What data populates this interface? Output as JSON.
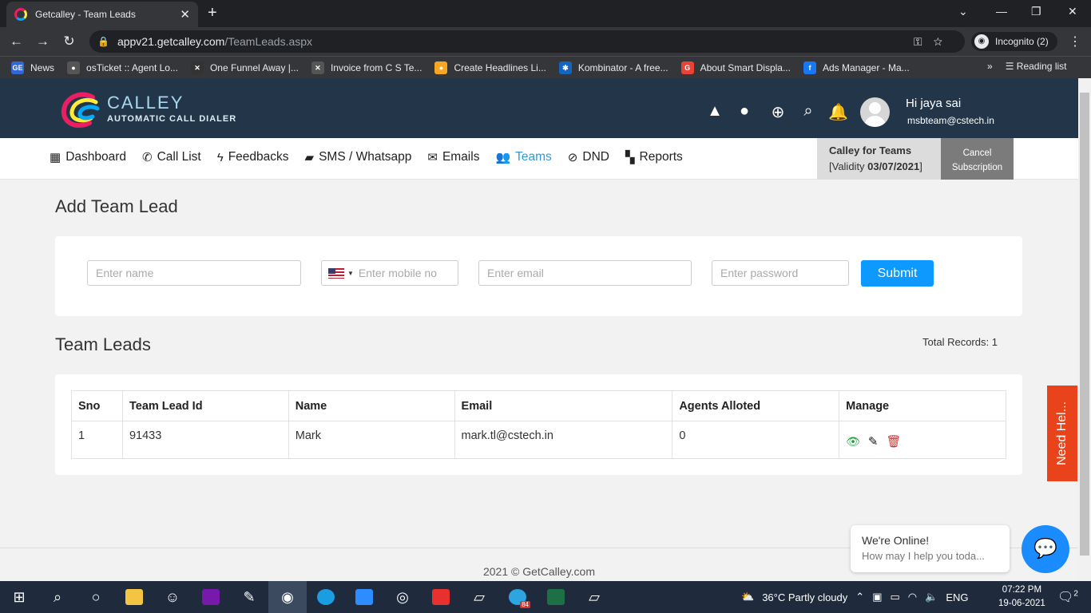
{
  "browser": {
    "tab_title": "Getcalley - Team Leads",
    "tab_close": "✕",
    "new_tab": "+",
    "url_host": "appv21.getcalley.com",
    "url_path": "/TeamLeads.aspx",
    "profile": "Incognito (2)",
    "bookmarks": [
      {
        "label": "News",
        "icon": "GE",
        "color": "#3367d6"
      },
      {
        "label": "osTicket :: Agent Lo...",
        "icon": "●",
        "color": "#555555"
      },
      {
        "label": "One Funnel Away |...",
        "icon": "✕",
        "color": "#333333"
      },
      {
        "label": "Invoice from C S Te...",
        "icon": "✕",
        "color": "#555555"
      },
      {
        "label": "Create Headlines Li...",
        "icon": "●",
        "color": "#f5a623"
      },
      {
        "label": "Kombinator - A free...",
        "icon": "✱",
        "color": "#1565c0"
      },
      {
        "label": "About Smart Displa...",
        "icon": "G",
        "color": "#ea4335"
      },
      {
        "label": "Ads Manager - Ma...",
        "icon": "f",
        "color": "#1877f2"
      }
    ],
    "more_bookmarks": "»",
    "reading_list": "Reading list"
  },
  "header": {
    "brand_name": "CALLEY",
    "brand_tagline": "AUTOMATIC CALL DIALER",
    "greeting": "Hi jaya sai",
    "user_email": "msbteam@cstech.in",
    "icons": [
      "android-icon",
      "apple-icon",
      "help-icon",
      "search-icon",
      "bell-icon"
    ]
  },
  "nav": {
    "items": [
      {
        "label": "Dashboard",
        "icon": "▦"
      },
      {
        "label": "Call List",
        "icon": "✆"
      },
      {
        "label": "Feedbacks",
        "icon": "ϟ"
      },
      {
        "label": "SMS / Whatsapp",
        "icon": "▰"
      },
      {
        "label": "Emails",
        "icon": "✉"
      },
      {
        "label": "Teams",
        "icon": "👥"
      },
      {
        "label": "DND",
        "icon": "⊘"
      },
      {
        "label": "Reports",
        "icon": "▚"
      }
    ],
    "active": "Teams",
    "plan_title": "Calley for Teams",
    "plan_validity_prefix": "[Validity ",
    "plan_validity_date": "03/07/2021",
    "plan_validity_suffix": "]",
    "cancel_label_1": "Cancel",
    "cancel_label_2": "Subscription"
  },
  "add_form": {
    "title": "Add Team Lead",
    "name_placeholder": "Enter name",
    "mobile_placeholder": "Enter mobile no",
    "email_placeholder": "Enter email",
    "password_placeholder": "Enter password",
    "submit_label": "Submit"
  },
  "team_leads": {
    "title": "Team Leads",
    "total_records": "Total Records: 1",
    "columns": [
      "Sno",
      "Team Lead Id",
      "Name",
      "Email",
      "Agents Alloted",
      "Manage"
    ],
    "rows": [
      {
        "sno": "1",
        "id": "91433",
        "name": "Mark",
        "email": "mark.tl@cstech.in",
        "agents": "0"
      }
    ]
  },
  "need_help": "Need Hel...",
  "footer": "2021 © GetCalley.com",
  "chat": {
    "line1": "We're Online!",
    "line2": "How may I help you toda..."
  },
  "taskbar": {
    "weather": "36°C  Partly cloudy",
    "lang": "ENG",
    "time": "07:22 PM",
    "date": "19-06-2021",
    "notifications": "2",
    "telegram_badge": "84"
  },
  "colors": {
    "header_bg": "#233649",
    "accent": "#0d99ff",
    "active_nav": "#3498db",
    "need_help": "#e8431a"
  }
}
